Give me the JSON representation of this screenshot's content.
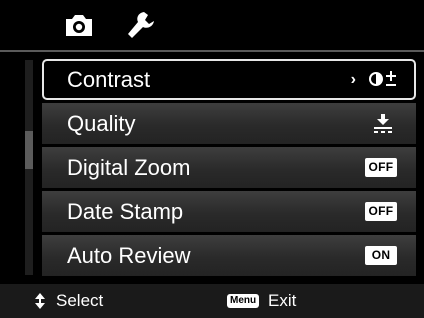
{
  "tabs": [
    {
      "icon": "camera-icon",
      "active": true
    },
    {
      "icon": "wrench-icon",
      "active": false
    }
  ],
  "menu": {
    "items": [
      {
        "label": "Contrast",
        "has_submenu_arrow": true,
        "arrow": "›",
        "value_icon": "contrast-adjust-icon",
        "selected": true
      },
      {
        "label": "Quality",
        "value_icon": "quality-fine-icon"
      },
      {
        "label": "Digital Zoom",
        "value": "OFF"
      },
      {
        "label": "Date Stamp",
        "value": "OFF"
      },
      {
        "label": "Auto Review",
        "value": "ON"
      }
    ]
  },
  "scrollbar": {
    "position_fraction": 0.4
  },
  "footer": {
    "select_icon": "up-down-arrows-icon",
    "select_label": "Select",
    "menu_key_label": "Menu",
    "exit_label": "Exit"
  },
  "colors": {
    "background": "#000000",
    "row": "#333333",
    "highlight_border": "#e7e7e7",
    "badge": "#ffffff"
  }
}
